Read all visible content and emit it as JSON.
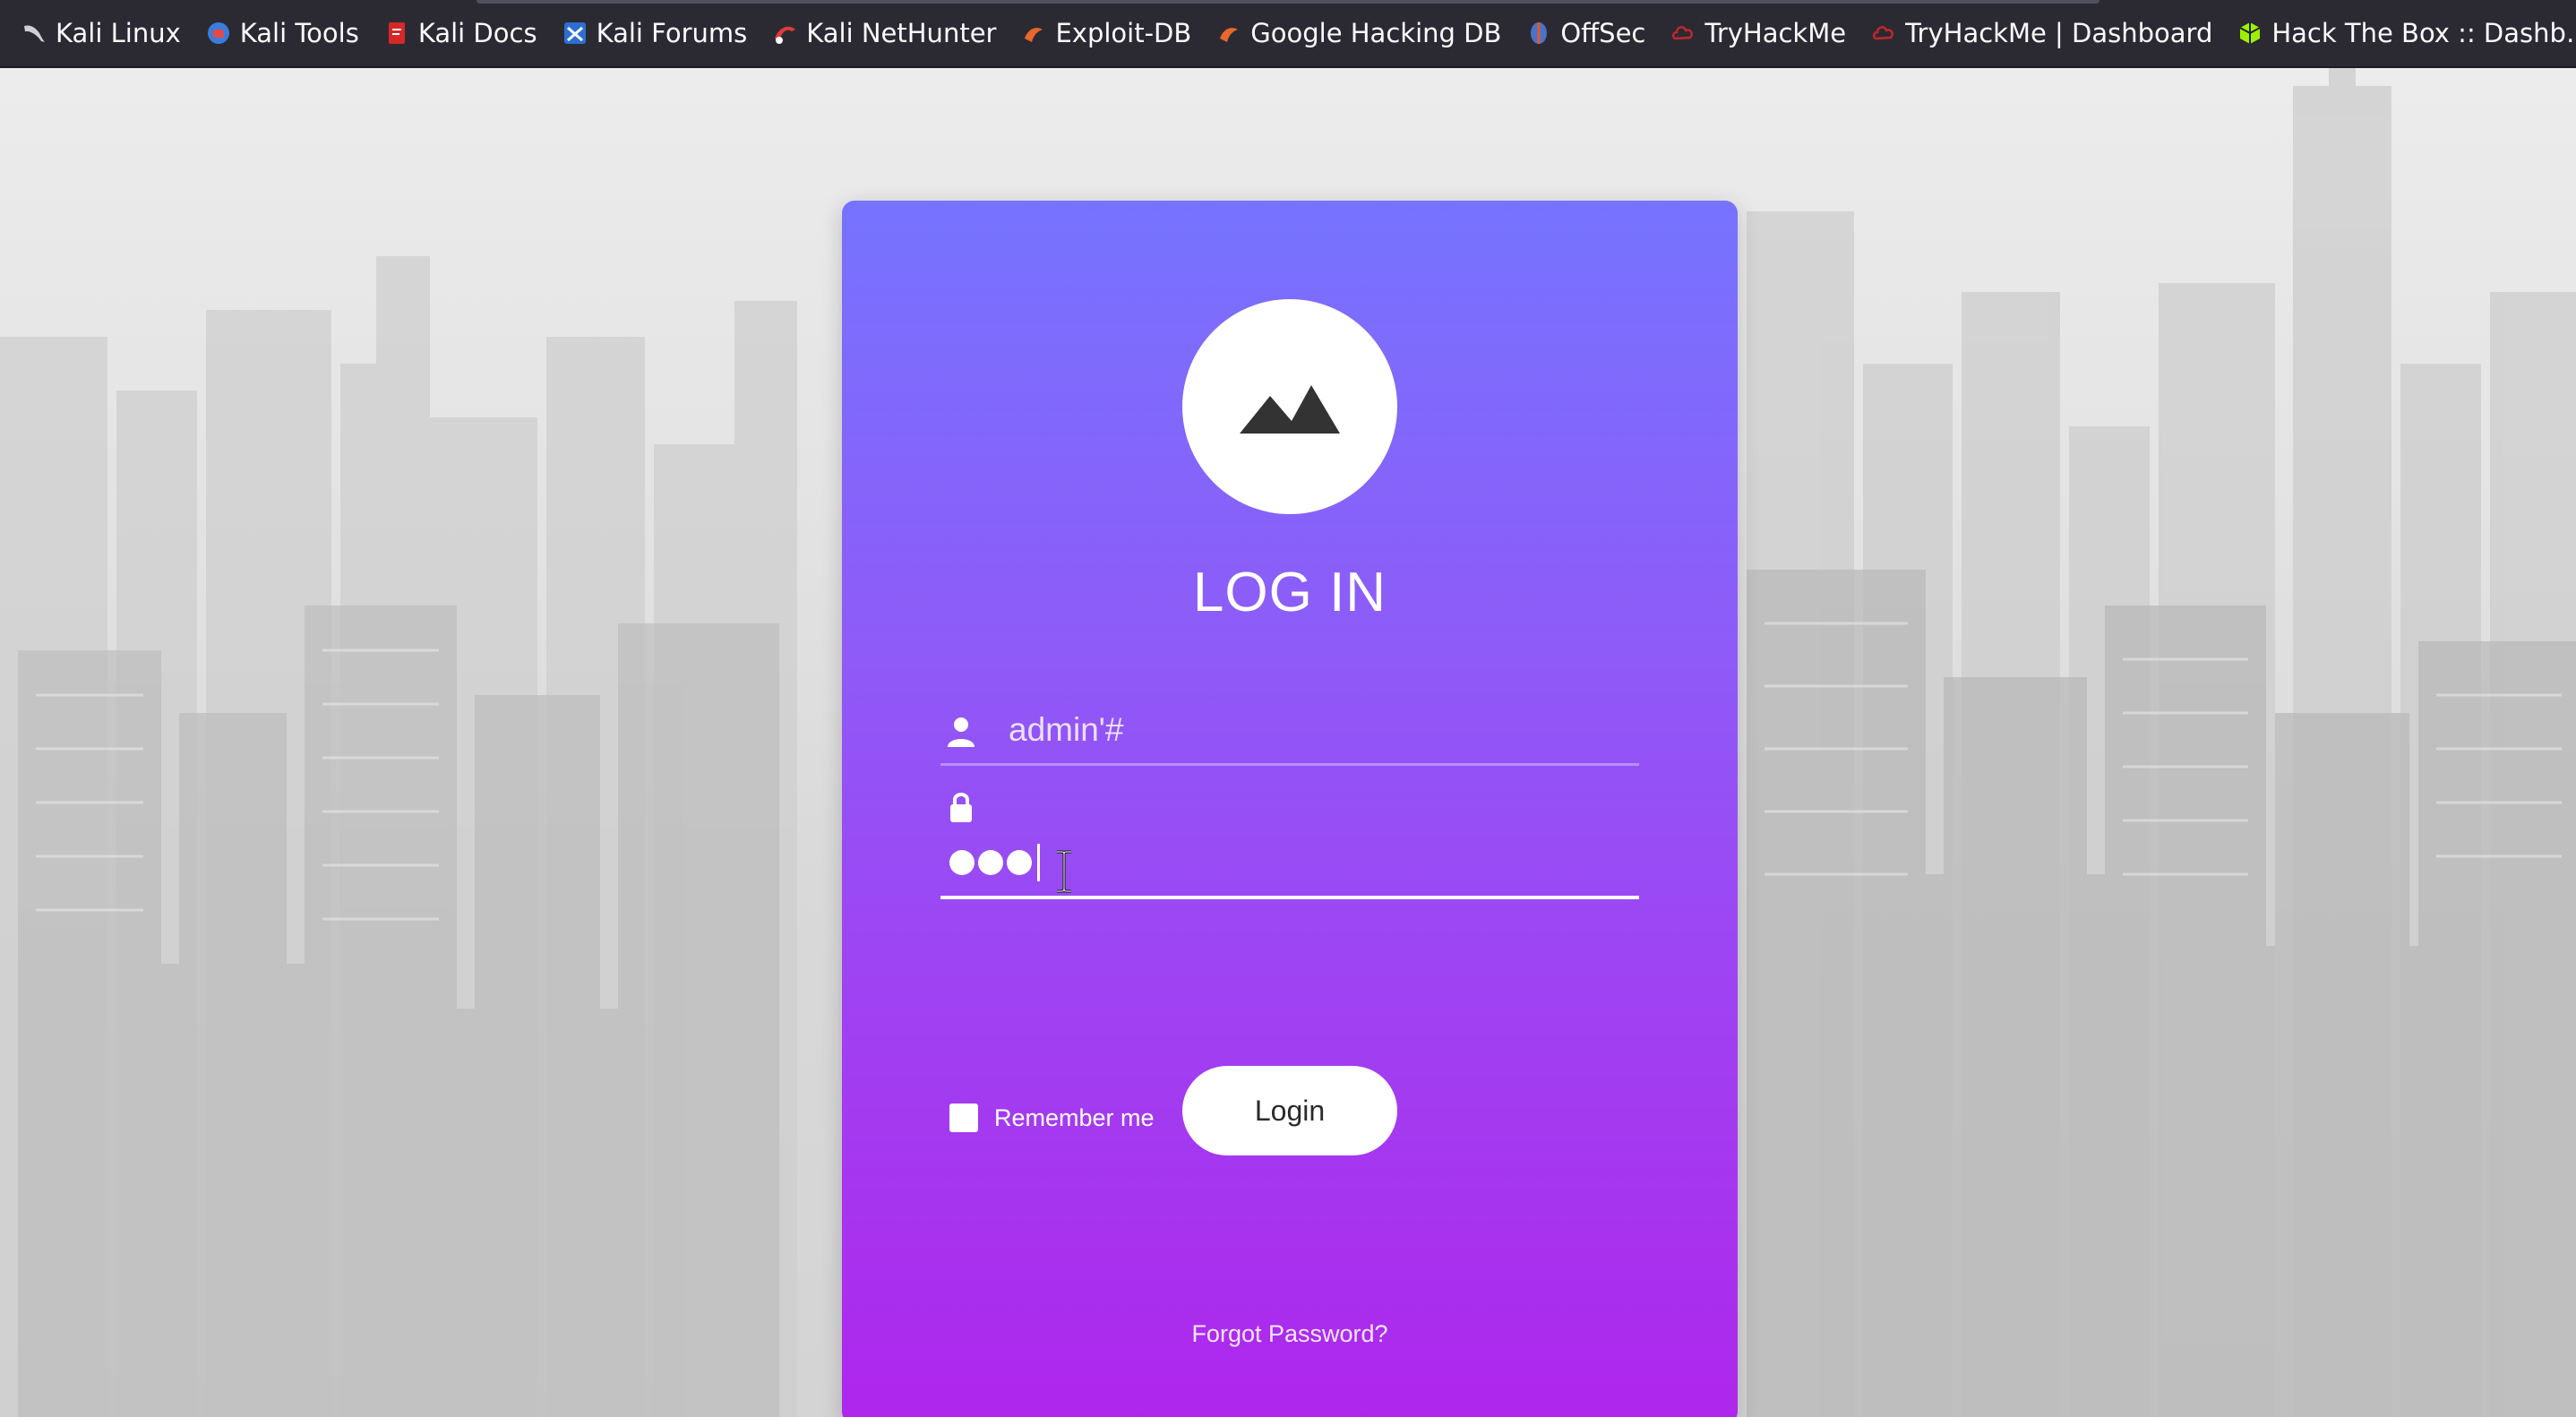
{
  "bookmarks": [
    {
      "label": "Kali Linux",
      "icon": "kali-dragon-icon"
    },
    {
      "label": "Kali Tools",
      "icon": "kali-tools-icon"
    },
    {
      "label": "Kali Docs",
      "icon": "kali-docs-icon"
    },
    {
      "label": "Kali Forums",
      "icon": "kali-forums-icon"
    },
    {
      "label": "Kali NetHunter",
      "icon": "kali-nethunter-icon"
    },
    {
      "label": "Exploit-DB",
      "icon": "exploit-db-icon"
    },
    {
      "label": "Google Hacking DB",
      "icon": "google-hacking-db-icon"
    },
    {
      "label": "OffSec",
      "icon": "offsec-icon"
    },
    {
      "label": "TryHackMe",
      "icon": "tryhackme-icon"
    },
    {
      "label": "TryHackMe | Dashboard",
      "icon": "tryhackme-icon"
    },
    {
      "label": "Hack The Box :: Dashb…",
      "icon": "hackthebox-icon"
    }
  ],
  "login": {
    "title": "LOG IN",
    "logo_icon": "mountain-icon",
    "username": {
      "value": "admin'#",
      "icon": "user-icon"
    },
    "password": {
      "masked_length": 3,
      "icon": "lock-icon"
    },
    "remember_label": "Remember me",
    "remember_checked": false,
    "button_label": "Login",
    "forgot_label": "Forgot Password?"
  },
  "colors": {
    "card_top": "#7673ff",
    "card_bottom": "#ae26ec",
    "bookmarks_bar": "#2b2a33"
  }
}
